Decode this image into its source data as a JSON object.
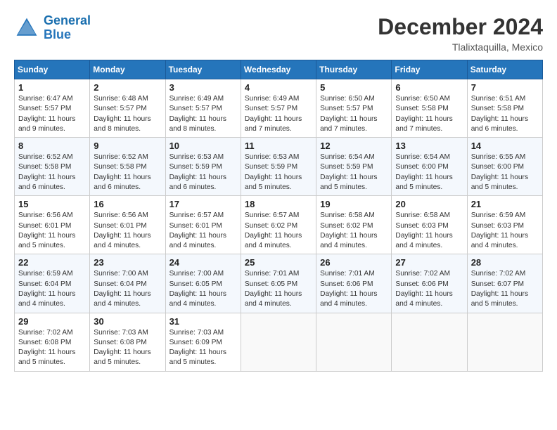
{
  "header": {
    "logo_line1": "General",
    "logo_line2": "Blue",
    "month_year": "December 2024",
    "location": "Tlalixtaquilla, Mexico"
  },
  "weekdays": [
    "Sunday",
    "Monday",
    "Tuesday",
    "Wednesday",
    "Thursday",
    "Friday",
    "Saturday"
  ],
  "weeks": [
    [
      {
        "day": "1",
        "info": "Sunrise: 6:47 AM\nSunset: 5:57 PM\nDaylight: 11 hours and 9 minutes."
      },
      {
        "day": "2",
        "info": "Sunrise: 6:48 AM\nSunset: 5:57 PM\nDaylight: 11 hours and 8 minutes."
      },
      {
        "day": "3",
        "info": "Sunrise: 6:49 AM\nSunset: 5:57 PM\nDaylight: 11 hours and 8 minutes."
      },
      {
        "day": "4",
        "info": "Sunrise: 6:49 AM\nSunset: 5:57 PM\nDaylight: 11 hours and 7 minutes."
      },
      {
        "day": "5",
        "info": "Sunrise: 6:50 AM\nSunset: 5:57 PM\nDaylight: 11 hours and 7 minutes."
      },
      {
        "day": "6",
        "info": "Sunrise: 6:50 AM\nSunset: 5:58 PM\nDaylight: 11 hours and 7 minutes."
      },
      {
        "day": "7",
        "info": "Sunrise: 6:51 AM\nSunset: 5:58 PM\nDaylight: 11 hours and 6 minutes."
      }
    ],
    [
      {
        "day": "8",
        "info": "Sunrise: 6:52 AM\nSunset: 5:58 PM\nDaylight: 11 hours and 6 minutes."
      },
      {
        "day": "9",
        "info": "Sunrise: 6:52 AM\nSunset: 5:58 PM\nDaylight: 11 hours and 6 minutes."
      },
      {
        "day": "10",
        "info": "Sunrise: 6:53 AM\nSunset: 5:59 PM\nDaylight: 11 hours and 6 minutes."
      },
      {
        "day": "11",
        "info": "Sunrise: 6:53 AM\nSunset: 5:59 PM\nDaylight: 11 hours and 5 minutes."
      },
      {
        "day": "12",
        "info": "Sunrise: 6:54 AM\nSunset: 5:59 PM\nDaylight: 11 hours and 5 minutes."
      },
      {
        "day": "13",
        "info": "Sunrise: 6:54 AM\nSunset: 6:00 PM\nDaylight: 11 hours and 5 minutes."
      },
      {
        "day": "14",
        "info": "Sunrise: 6:55 AM\nSunset: 6:00 PM\nDaylight: 11 hours and 5 minutes."
      }
    ],
    [
      {
        "day": "15",
        "info": "Sunrise: 6:56 AM\nSunset: 6:01 PM\nDaylight: 11 hours and 5 minutes."
      },
      {
        "day": "16",
        "info": "Sunrise: 6:56 AM\nSunset: 6:01 PM\nDaylight: 11 hours and 4 minutes."
      },
      {
        "day": "17",
        "info": "Sunrise: 6:57 AM\nSunset: 6:01 PM\nDaylight: 11 hours and 4 minutes."
      },
      {
        "day": "18",
        "info": "Sunrise: 6:57 AM\nSunset: 6:02 PM\nDaylight: 11 hours and 4 minutes."
      },
      {
        "day": "19",
        "info": "Sunrise: 6:58 AM\nSunset: 6:02 PM\nDaylight: 11 hours and 4 minutes."
      },
      {
        "day": "20",
        "info": "Sunrise: 6:58 AM\nSunset: 6:03 PM\nDaylight: 11 hours and 4 minutes."
      },
      {
        "day": "21",
        "info": "Sunrise: 6:59 AM\nSunset: 6:03 PM\nDaylight: 11 hours and 4 minutes."
      }
    ],
    [
      {
        "day": "22",
        "info": "Sunrise: 6:59 AM\nSunset: 6:04 PM\nDaylight: 11 hours and 4 minutes."
      },
      {
        "day": "23",
        "info": "Sunrise: 7:00 AM\nSunset: 6:04 PM\nDaylight: 11 hours and 4 minutes."
      },
      {
        "day": "24",
        "info": "Sunrise: 7:00 AM\nSunset: 6:05 PM\nDaylight: 11 hours and 4 minutes."
      },
      {
        "day": "25",
        "info": "Sunrise: 7:01 AM\nSunset: 6:05 PM\nDaylight: 11 hours and 4 minutes."
      },
      {
        "day": "26",
        "info": "Sunrise: 7:01 AM\nSunset: 6:06 PM\nDaylight: 11 hours and 4 minutes."
      },
      {
        "day": "27",
        "info": "Sunrise: 7:02 AM\nSunset: 6:06 PM\nDaylight: 11 hours and 4 minutes."
      },
      {
        "day": "28",
        "info": "Sunrise: 7:02 AM\nSunset: 6:07 PM\nDaylight: 11 hours and 5 minutes."
      }
    ],
    [
      {
        "day": "29",
        "info": "Sunrise: 7:02 AM\nSunset: 6:08 PM\nDaylight: 11 hours and 5 minutes."
      },
      {
        "day": "30",
        "info": "Sunrise: 7:03 AM\nSunset: 6:08 PM\nDaylight: 11 hours and 5 minutes."
      },
      {
        "day": "31",
        "info": "Sunrise: 7:03 AM\nSunset: 6:09 PM\nDaylight: 11 hours and 5 minutes."
      },
      {
        "day": "",
        "info": ""
      },
      {
        "day": "",
        "info": ""
      },
      {
        "day": "",
        "info": ""
      },
      {
        "day": "",
        "info": ""
      }
    ]
  ]
}
